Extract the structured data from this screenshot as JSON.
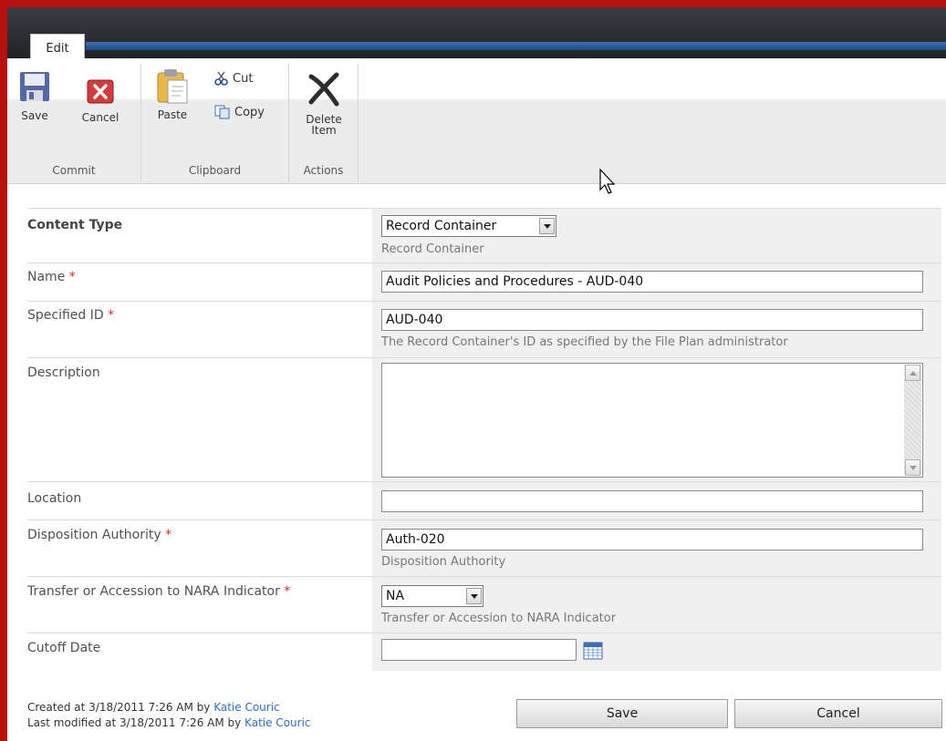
{
  "ribbon": {
    "tab_edit": "Edit",
    "commit": {
      "label": "Commit",
      "save": "Save",
      "cancel": "Cancel"
    },
    "clipboard": {
      "label": "Clipboard",
      "paste": "Paste",
      "cut": "Cut",
      "copy": "Copy"
    },
    "actions": {
      "label": "Actions",
      "delete_line1": "Delete",
      "delete_line2": "Item"
    }
  },
  "form": {
    "content_type": {
      "label": "Content Type",
      "value": "Record Container",
      "hint": "Record Container"
    },
    "name": {
      "label": "Name",
      "value": "Audit Policies and Procedures - AUD-040"
    },
    "specified_id": {
      "label": "Specified ID",
      "value": "AUD-040",
      "hint": "The Record Container's ID as specified by the File Plan administrator"
    },
    "description": {
      "label": "Description",
      "value": ""
    },
    "location": {
      "label": "Location",
      "value": ""
    },
    "disposition_authority": {
      "label": "Disposition Authority",
      "value": "Auth-020",
      "hint": "Disposition Authority"
    },
    "nara": {
      "label": "Transfer or Accession to NARA Indicator",
      "value": "NA",
      "hint": "Transfer or Accession to NARA Indicator"
    },
    "cutoff_date": {
      "label": "Cutoff Date",
      "value": ""
    },
    "required_marker": "*"
  },
  "footer": {
    "created_prefix": "Created at 3/18/2011 7:26 AM by ",
    "created_by": "Katie Couric",
    "modified_prefix": "Last modified at 3/18/2011 7:26 AM by ",
    "modified_by": "Katie Couric",
    "save": "Save",
    "cancel": "Cancel"
  },
  "colors": {
    "accent_red": "#b80f0f",
    "link": "#2a6ecb",
    "required": "#d42b2b"
  }
}
